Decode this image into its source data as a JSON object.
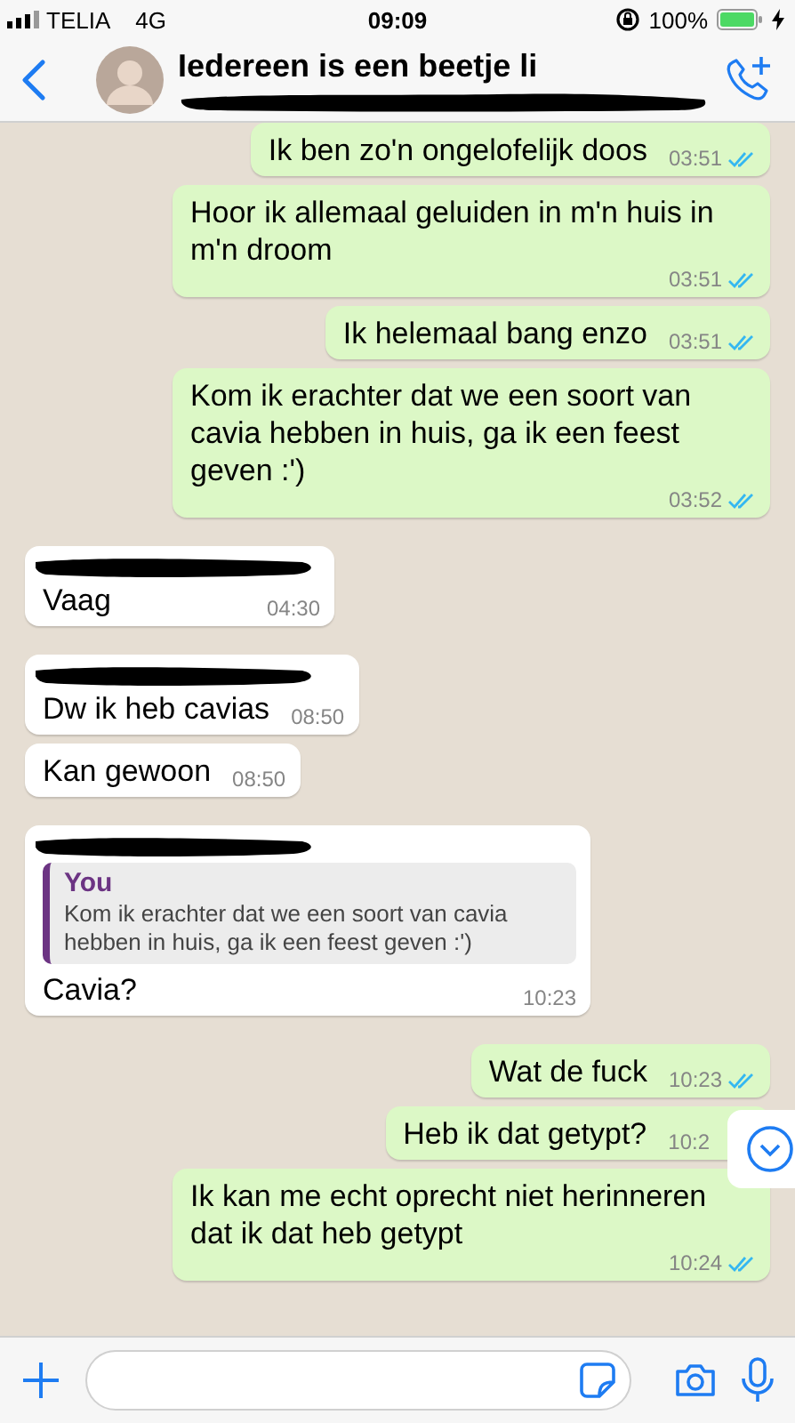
{
  "status_bar": {
    "carrier": "TELIA",
    "network": "4G",
    "time": "09:09",
    "battery": "100%",
    "charging": true
  },
  "header": {
    "title": "Iedereen is een beetje li",
    "subtitle_redacted": true
  },
  "messages": [
    {
      "kind": "out",
      "text": "Ik ben zo'n ongelofelijk doos",
      "time": "03:51",
      "read": true
    },
    {
      "kind": "out",
      "text": "Hoor ik allemaal geluiden in m'n huis in m'n droom",
      "time": "03:51",
      "read": true
    },
    {
      "kind": "out",
      "text": "Ik helemaal bang enzo",
      "time": "03:51",
      "read": true
    },
    {
      "kind": "out",
      "text": "Kom ik erachter dat we een soort van cavia hebben in huis, ga ik een feest geven :')",
      "time": "03:52",
      "read": true
    },
    {
      "kind": "in",
      "sender_redacted": true,
      "text": "Vaag",
      "time": "04:30"
    },
    {
      "kind": "in",
      "sender_redacted": true,
      "text": "Dw ik heb cavias",
      "time": "08:50"
    },
    {
      "kind": "in",
      "sender_redacted": false,
      "text": "Kan gewoon",
      "time": "08:50"
    },
    {
      "kind": "in",
      "sender_redacted": true,
      "quote": {
        "author": "You",
        "text": "Kom ik erachter dat we een soort van cavia hebben in huis, ga ik een feest geven :')"
      },
      "text": "Cavia?",
      "time": "10:23"
    },
    {
      "kind": "out",
      "text": "Wat de fuck",
      "time": "10:23",
      "read": true
    },
    {
      "kind": "out",
      "text": "Heb ik dat getypt?",
      "time": "10:2"
    },
    {
      "kind": "out",
      "text": "Ik kan me echt oprecht niet herinneren dat ik dat heb getypt",
      "time": "10:24",
      "read": true
    }
  ]
}
